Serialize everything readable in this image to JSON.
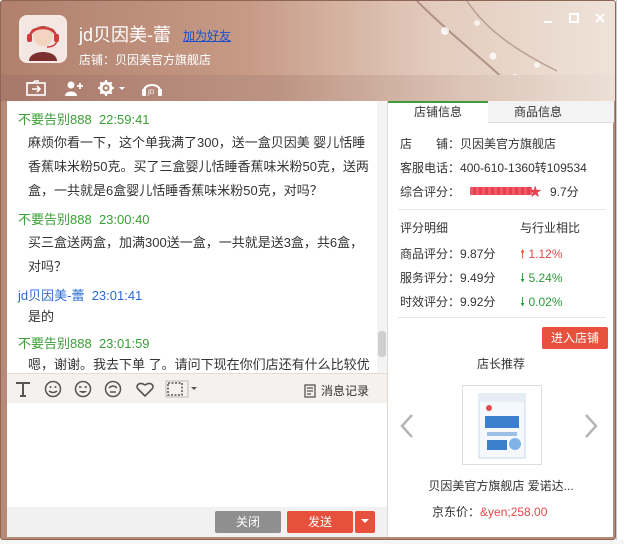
{
  "window": {
    "title": "jd贝因美-蕾",
    "add_friend": "加为好友",
    "shop_line": "店铺：贝因美官方旗舰店"
  },
  "chat": {
    "messages": [
      {
        "sender": "不要告别888",
        "time": "22:59:41",
        "lines": [
          "麻烦你看一下，这个单我满了300，送一盒贝因美 婴儿恬睡",
          "香蕉味米粉50克。买了三盒婴儿恬睡香蕉味米粉50克，送两",
          "盒，一共就是6盒婴儿恬睡香蕉味米粉50克，对吗？"
        ]
      },
      {
        "sender": "不要告别888",
        "time": "23:00:40",
        "lines": [
          "买三盒送两盒，加满300送一盒，一共就是送3盒，共6盒，",
          "对吗？"
        ]
      },
      {
        "sender": "jd贝因美-蕾",
        "time": "23:01:41",
        "lines": [
          "是的"
        ]
      },
      {
        "sender": "不要告别888",
        "time": "23:01:59",
        "lines": [
          "嗯，谢谢。我去下单 了。请问下现在你们店还有什么比较优"
        ]
      }
    ]
  },
  "input_toolbar": {
    "history_label": "消息记录"
  },
  "buttons": {
    "close": "关闭",
    "send": "发送"
  },
  "panel": {
    "tabs": [
      "店铺信息",
      "商品信息"
    ],
    "shop_label": "店　　铺：",
    "shop_value": "贝因美官方旗舰店",
    "phone_label": "客服电话：",
    "phone_value": "400-610-1360转109534",
    "overall_label": "综合评分：",
    "overall_value": "9.7分",
    "detail_header": "评分明细",
    "compare_header": "与行业相比",
    "scores": [
      {
        "label": "商品评分：",
        "value": "9.87分",
        "dir": "up",
        "pct": "1.12%"
      },
      {
        "label": "服务评分：",
        "value": "9.49分",
        "dir": "down",
        "pct": "5.24%"
      },
      {
        "label": "时效评分：",
        "value": "9.92分",
        "dir": "down",
        "pct": "0.02%"
      }
    ],
    "enter_shop": "进入店铺",
    "recommend_title": "店长推荐",
    "product_name": "贝因美官方旗舰店 爱诺达...",
    "price_label": "京东价：",
    "price_value": "&yen;258.00"
  },
  "colors": {
    "accent_green": "#3aa036",
    "accent_blue": "#2a6bd1",
    "send_red": "#e7503c",
    "header_brown": "#b0806d"
  }
}
